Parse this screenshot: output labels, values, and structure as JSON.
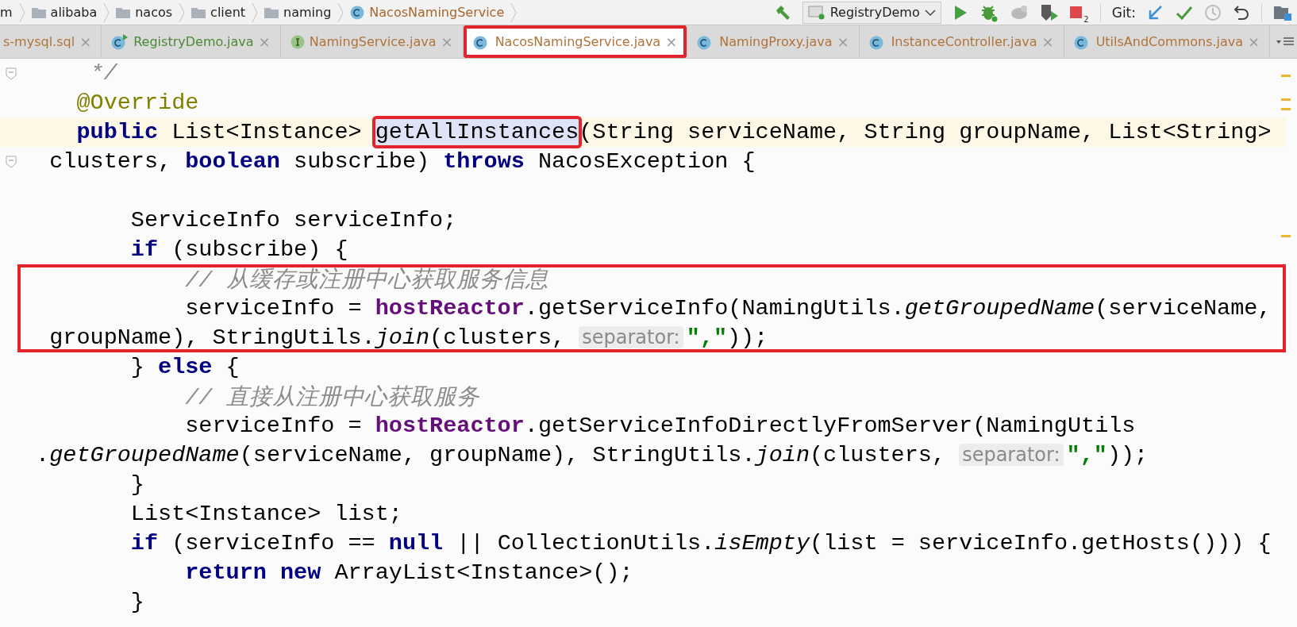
{
  "breadcrumbs": [
    {
      "label": "m",
      "kind": "cut"
    },
    {
      "label": "alibaba",
      "kind": "folder"
    },
    {
      "label": "nacos",
      "kind": "folder"
    },
    {
      "label": "client",
      "kind": "folder"
    },
    {
      "label": "naming",
      "kind": "folder"
    },
    {
      "label": "NacosNamingService",
      "kind": "class"
    }
  ],
  "toolbar": {
    "run_config": "RegistryDemo",
    "stop_badge": "2",
    "vcs_label": "Git:"
  },
  "tabs": [
    {
      "label": "s-mysql.sql",
      "kind": "cut",
      "color": "#b0733a",
      "selected": false,
      "boxed": false,
      "close": "×"
    },
    {
      "label": "RegistryDemo.java",
      "kind": "runnable",
      "color": "#4b8a35",
      "selected": false,
      "boxed": false,
      "close": "×"
    },
    {
      "label": "NamingService.java",
      "kind": "interface",
      "color": "#b0733a",
      "selected": false,
      "boxed": false,
      "close": "×"
    },
    {
      "label": "NacosNamingService.java",
      "kind": "class",
      "color": "#b0733a",
      "selected": true,
      "boxed": true,
      "close": "×"
    },
    {
      "label": "NamingProxy.java",
      "kind": "class",
      "color": "#b0733a",
      "selected": false,
      "boxed": false,
      "close": "×"
    },
    {
      "label": "InstanceController.java",
      "kind": "class",
      "color": "#b0733a",
      "selected": false,
      "boxed": false,
      "close": "×"
    },
    {
      "label": "UtilsAndCommons.java",
      "kind": "class",
      "color": "#b0733a",
      "selected": false,
      "boxed": false,
      "close": "×"
    }
  ],
  "code": [
    {
      "current": false,
      "boxed": false,
      "fold": true,
      "tokens": [
        {
          "kind": "comment",
          "text": "     */"
        }
      ]
    },
    {
      "current": false,
      "boxed": false,
      "fold": false,
      "tokens": [
        {
          "kind": "ann",
          "text": "    @Override"
        }
      ]
    },
    {
      "current": true,
      "boxed": false,
      "fold": false,
      "tokens": [
        {
          "kind": "kw",
          "text": "    public"
        },
        {
          "kind": "plain",
          "text": " List<Instance> "
        },
        {
          "kind": "plain",
          "text": "getAllInstances",
          "selected": true,
          "boxed": true
        },
        {
          "kind": "plain",
          "text": "(String serviceName, String groupName, List<String>"
        }
      ]
    },
    {
      "current": false,
      "boxed": false,
      "fold": true,
      "tokens": [
        {
          "kind": "plain",
          "text": "  clusters, "
        },
        {
          "kind": "kw",
          "text": "boolean"
        },
        {
          "kind": "plain",
          "text": " subscribe) "
        },
        {
          "kind": "kw",
          "text": "throws"
        },
        {
          "kind": "plain",
          "text": " NacosException {"
        }
      ]
    },
    {
      "current": false,
      "boxed": false,
      "fold": false
    },
    {
      "current": false,
      "boxed": false,
      "fold": false,
      "tokens": [
        {
          "kind": "plain",
          "text": "        ServiceInfo serviceInfo;"
        }
      ]
    },
    {
      "current": false,
      "boxed": false,
      "fold": false,
      "tokens": [
        {
          "kind": "kw",
          "text": "        if"
        },
        {
          "kind": "plain",
          "text": " (subscribe) {"
        }
      ]
    },
    {
      "current": false,
      "boxed": true,
      "fold": false,
      "tokens": [
        {
          "kind": "comment",
          "text": "            // 从缓存或注册中心获取服务信息"
        }
      ]
    },
    {
      "current": false,
      "boxed": true,
      "fold": false,
      "tokens": [
        {
          "kind": "plain",
          "text": "            serviceInfo = "
        },
        {
          "kind": "field",
          "text": "hostReactor"
        },
        {
          "kind": "plain",
          "text": ".getServiceInfo(NamingUtils."
        },
        {
          "kind": "static",
          "text": "getGroupedName"
        },
        {
          "kind": "plain",
          "text": "(serviceName,"
        }
      ]
    },
    {
      "current": false,
      "boxed": true,
      "fold": false,
      "tokens": [
        {
          "kind": "plain",
          "text": "  groupName), StringUtils."
        },
        {
          "kind": "static",
          "text": "join"
        },
        {
          "kind": "plain",
          "text": "(clusters, "
        },
        {
          "kind": "hint",
          "text": "separator:"
        },
        {
          "kind": "string",
          "text": "\",\""
        },
        {
          "kind": "plain",
          "text": "));"
        }
      ]
    },
    {
      "current": false,
      "boxed": false,
      "fold": false,
      "tokens": [
        {
          "kind": "plain",
          "text": "        } "
        },
        {
          "kind": "kw",
          "text": "else"
        },
        {
          "kind": "plain",
          "text": " {"
        }
      ]
    },
    {
      "current": false,
      "boxed": false,
      "fold": false,
      "tokens": [
        {
          "kind": "comment",
          "text": "            // 直接从注册中心获取服务"
        }
      ]
    },
    {
      "current": false,
      "boxed": false,
      "fold": false,
      "tokens": [
        {
          "kind": "plain",
          "text": "            serviceInfo = "
        },
        {
          "kind": "field",
          "text": "hostReactor"
        },
        {
          "kind": "plain",
          "text": ".getServiceInfoDirectlyFromServer(NamingUtils"
        }
      ]
    },
    {
      "current": false,
      "boxed": false,
      "fold": false,
      "tokens": [
        {
          "kind": "plain",
          "text": " ."
        },
        {
          "kind": "static",
          "text": "getGroupedName"
        },
        {
          "kind": "plain",
          "text": "(serviceName, groupName), StringUtils."
        },
        {
          "kind": "static",
          "text": "join"
        },
        {
          "kind": "plain",
          "text": "(clusters, "
        },
        {
          "kind": "hint",
          "text": "separator:"
        },
        {
          "kind": "string",
          "text": "\",\""
        },
        {
          "kind": "plain",
          "text": "));"
        }
      ]
    },
    {
      "current": false,
      "boxed": false,
      "fold": false,
      "tokens": [
        {
          "kind": "plain",
          "text": "        }"
        }
      ]
    },
    {
      "current": false,
      "boxed": false,
      "fold": false,
      "tokens": [
        {
          "kind": "plain",
          "text": "        List<Instance> list;"
        }
      ]
    },
    {
      "current": false,
      "boxed": false,
      "fold": false,
      "tokens": [
        {
          "kind": "kw",
          "text": "        if"
        },
        {
          "kind": "plain",
          "text": " (serviceInfo == "
        },
        {
          "kind": "kw",
          "text": "null"
        },
        {
          "kind": "plain",
          "text": " || CollectionUtils."
        },
        {
          "kind": "static",
          "text": "isEmpty"
        },
        {
          "kind": "plain",
          "text": "(list = serviceInfo.getHosts())) {"
        }
      ]
    },
    {
      "current": false,
      "boxed": false,
      "fold": false,
      "tokens": [
        {
          "kind": "kw",
          "text": "            return new"
        },
        {
          "kind": "plain",
          "text": " ArrayList<Instance>();"
        }
      ]
    },
    {
      "current": false,
      "boxed": false,
      "fold": false,
      "tokens": [
        {
          "kind": "plain",
          "text": "        }"
        }
      ]
    }
  ]
}
